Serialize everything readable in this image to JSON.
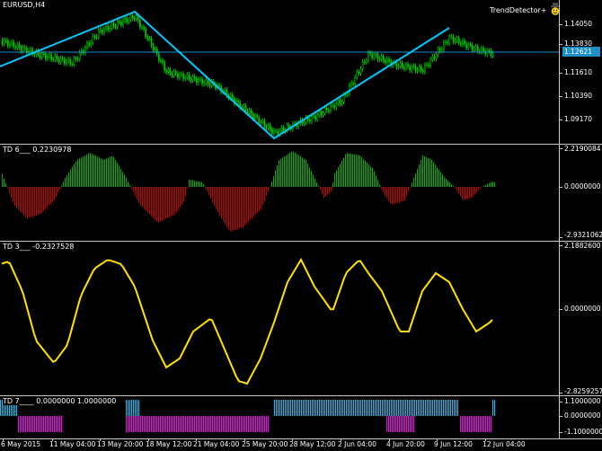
{
  "main": {
    "symbol_label": "EURUSD,H4",
    "expert_label": "TrendDetector+",
    "expert_icon": "smiley-hat-icon",
    "current_price": "1.12621",
    "y_ticks": [
      "1.14050",
      "1.13830",
      "1.11610",
      "1.10390",
      "1.09170"
    ],
    "colors": {
      "bull": "#00c800",
      "trendline": "#00c8ff",
      "price_line": "#1e90c8"
    }
  },
  "td6": {
    "label": "TD 6___ 0.2230978",
    "y_ticks": [
      "2.2190084",
      "0.0000000",
      "-2.9321062"
    ],
    "colors": {
      "positive": "#00b400",
      "negative": "#c80000"
    }
  },
  "td3": {
    "label": "TD 3___ -0.2327528",
    "y_ticks": [
      "2.1882600",
      "0.0000000",
      "-2.8259257"
    ],
    "colors": {
      "line": "#ffe000"
    }
  },
  "td7": {
    "label": "TD 7____ 0.0000000 1.0000000",
    "y_ticks": [
      "1.1000000",
      "0.0000000",
      "-1.1000000"
    ],
    "colors": {
      "up": "#00c8ff",
      "down": "#ff00ff"
    }
  },
  "x_axis": [
    "6 May 2015",
    "11 May 04:00",
    "13 May 20:00",
    "18 May 12:00",
    "21 May 04:00",
    "25 May 20:00",
    "28 May 12:00",
    "2 Jun 04:00",
    "4 Jun 20:00",
    "9 Jun 12:00",
    "12 Jun 04:00"
  ]
}
